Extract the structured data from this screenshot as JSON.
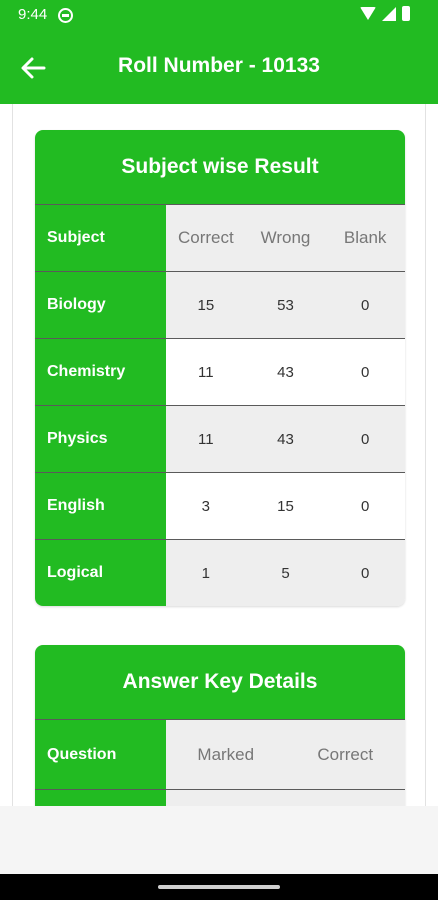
{
  "status_bar": {
    "time": "9:44"
  },
  "app_bar": {
    "title": "Roll Number - 10133"
  },
  "subject_result": {
    "title": "Subject wise Result",
    "columns": {
      "subject": "Subject",
      "correct": "Correct",
      "wrong": "Wrong",
      "blank": "Blank"
    },
    "rows": [
      {
        "subject": "Biology",
        "correct": "15",
        "wrong": "53",
        "blank": "0"
      },
      {
        "subject": "Chemistry",
        "correct": "11",
        "wrong": "43",
        "blank": "0"
      },
      {
        "subject": "Physics",
        "correct": "11",
        "wrong": "43",
        "blank": "0"
      },
      {
        "subject": "English",
        "correct": "3",
        "wrong": "15",
        "blank": "0"
      },
      {
        "subject": "Logical",
        "correct": "1",
        "wrong": "5",
        "blank": "0"
      }
    ]
  },
  "answer_key": {
    "title": "Answer Key Details",
    "columns": {
      "question": "Question",
      "marked": "Marked",
      "correct": "Correct"
    }
  },
  "colors": {
    "primary": "#22bb22",
    "shaded_cell": "#eeeeee",
    "text": "#333333"
  }
}
